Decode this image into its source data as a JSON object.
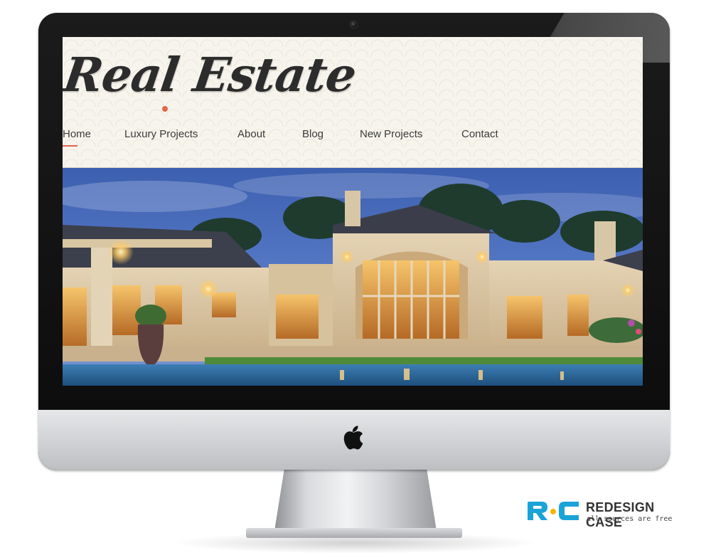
{
  "site": {
    "logo_text": "Real Estate",
    "nav": [
      {
        "label": "Home",
        "active": true
      },
      {
        "label": "Luxury Projects",
        "active": false
      },
      {
        "label": "About",
        "active": false
      },
      {
        "label": "Blog",
        "active": false
      },
      {
        "label": "New Projects",
        "active": false
      },
      {
        "label": "Contact",
        "active": false
      }
    ],
    "accent_color": "#e2664a",
    "text_color": "#3b3b3b",
    "hero_image": "luxury-house-at-dusk-with-pool"
  },
  "device": {
    "type": "imac",
    "logo_icon": "apple-icon"
  },
  "branding": {
    "logo_mark": "RC",
    "title": "REDESIGN CASE",
    "subtitle": "all sources are free",
    "color": "#1aa3d8"
  }
}
